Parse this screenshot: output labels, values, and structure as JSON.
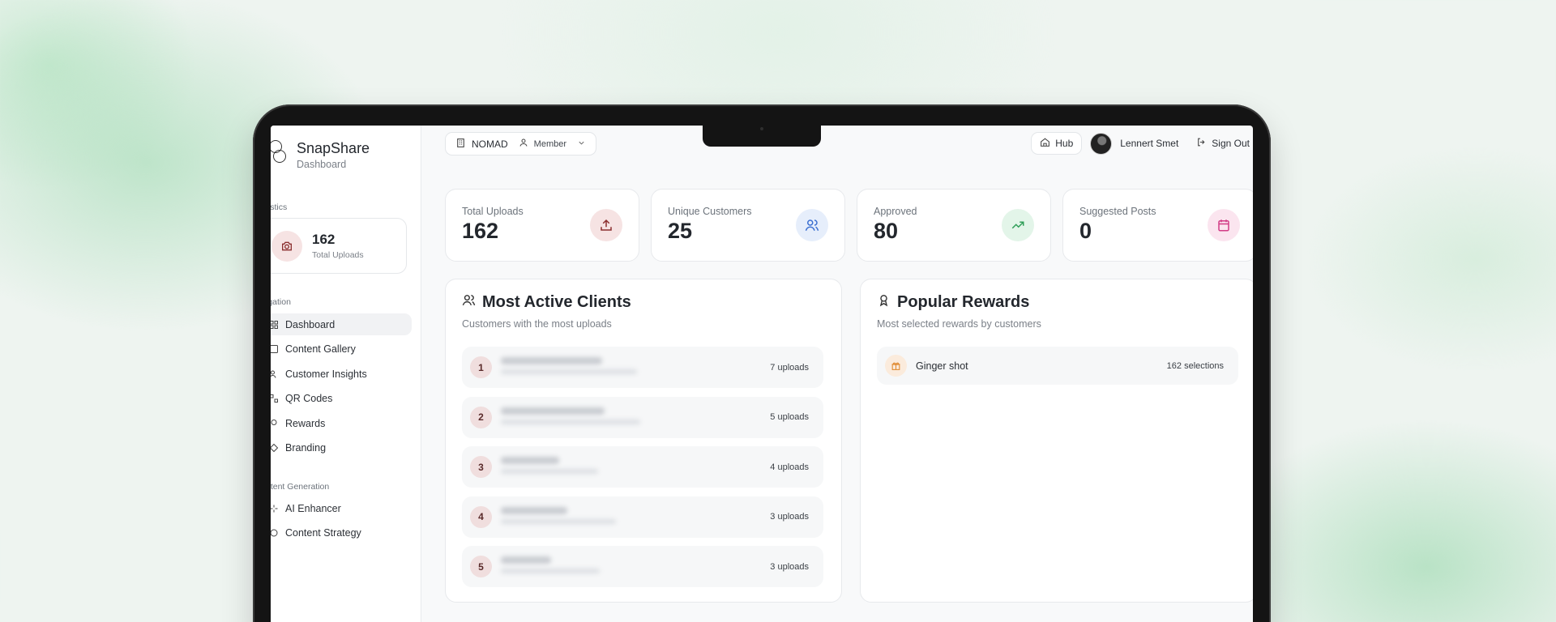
{
  "brand": {
    "name": "SnapShare",
    "subtitle": "Dashboard"
  },
  "sidebar": {
    "statistics_label": "tistics",
    "mini_stat": {
      "value": "162",
      "label": "Total Uploads",
      "icon": "camera-icon"
    },
    "navigation_label": "igation",
    "nav_items": [
      {
        "label": "Dashboard",
        "icon": "dashboard-icon",
        "active": true
      },
      {
        "label": "Content Gallery",
        "icon": "gallery-icon"
      },
      {
        "label": "Customer Insights",
        "icon": "insights-icon"
      },
      {
        "label": "QR Codes",
        "icon": "qr-icon"
      },
      {
        "label": "Rewards",
        "icon": "reward-icon"
      },
      {
        "label": "Branding",
        "icon": "branding-icon"
      }
    ],
    "content_label": "ntent Generation",
    "content_items": [
      {
        "label": "AI Enhancer",
        "icon": "sparkle-icon"
      },
      {
        "label": "Content Strategy",
        "icon": "strategy-icon"
      }
    ]
  },
  "topbar": {
    "workspace": "NOMAD",
    "role": "Member",
    "hub_label": "Hub",
    "user_name": "Lennert Smet",
    "signout_label": "Sign Out"
  },
  "stats": [
    {
      "label": "Total Uploads",
      "value": "162",
      "icon": "upload-icon",
      "color": "#8b2f2f",
      "bg": "#f6e3e3"
    },
    {
      "label": "Unique Customers",
      "value": "25",
      "icon": "users-icon",
      "color": "#3b6fd1",
      "bg": "#e6eefb"
    },
    {
      "label": "Approved",
      "value": "80",
      "icon": "trending-up-icon",
      "color": "#2f9e58",
      "bg": "#e3f5e9"
    },
    {
      "label": "Suggested Posts",
      "value": "0",
      "icon": "calendar-icon",
      "color": "#d23c86",
      "bg": "#fbe5ef"
    }
  ],
  "clients_panel": {
    "title": "Most Active Clients",
    "subtitle": "Customers with the most uploads",
    "rows": [
      {
        "rank": "1",
        "uploads": "7 uploads"
      },
      {
        "rank": "2",
        "uploads": "5 uploads"
      },
      {
        "rank": "3",
        "uploads": "4 uploads"
      },
      {
        "rank": "4",
        "uploads": "3 uploads"
      },
      {
        "rank": "5",
        "uploads": "3 uploads"
      }
    ]
  },
  "rewards_panel": {
    "title": "Popular Rewards",
    "subtitle": "Most selected rewards by customers",
    "rows": [
      {
        "name": "Ginger shot",
        "count": "162 selections"
      }
    ]
  }
}
